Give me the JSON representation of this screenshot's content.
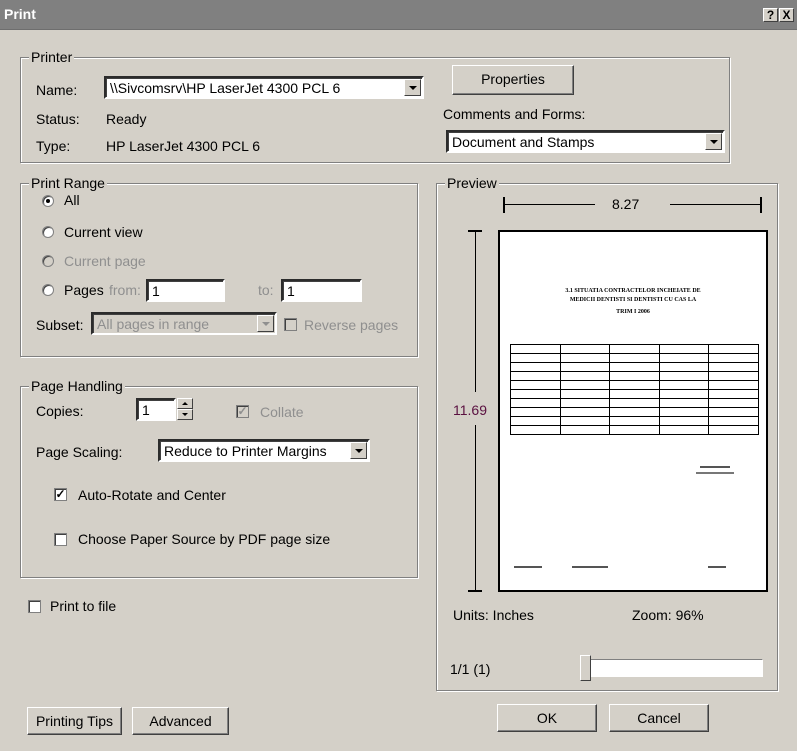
{
  "window": {
    "title": "Print",
    "help_label": "?",
    "close_label": "X"
  },
  "printer": {
    "group_label": "Printer",
    "name_label": "Name:",
    "name_value": "\\\\Sivcomsrv\\HP LaserJet 4300 PCL 6",
    "status_label": "Status:",
    "status_value": "Ready",
    "type_label": "Type:",
    "type_value": "HP LaserJet 4300 PCL 6",
    "properties_label": "Properties",
    "comments_label": "Comments and Forms:",
    "comments_value": "Document and Stamps"
  },
  "print_range": {
    "group_label": "Print Range",
    "all_label": "All",
    "current_view_label": "Current view",
    "current_page_label": "Current page",
    "pages_label": "Pages",
    "from_label": "from:",
    "from_value": "1",
    "to_label": "to:",
    "to_value": "1",
    "subset_label": "Subset:",
    "subset_value": "All pages in range",
    "reverse_label": "Reverse pages",
    "selected": "All"
  },
  "page_handling": {
    "group_label": "Page Handling",
    "copies_label": "Copies:",
    "copies_value": "1",
    "collate_label": "Collate",
    "scaling_label": "Page Scaling:",
    "scaling_value": "Reduce to Printer Margins",
    "auto_rotate_label": "Auto-Rotate and Center",
    "auto_rotate_checked": true,
    "paper_source_label": "Choose Paper Source by PDF page size",
    "paper_source_checked": false
  },
  "print_to_file_label": "Print to file",
  "preview": {
    "group_label": "Preview",
    "width_value": "8.27",
    "height_value": "11.69",
    "units_text": "Units: Inches",
    "zoom_text": "Zoom:  96%",
    "page_indicator": "1/1 (1)",
    "doc_title_line1": "3.1 SITUATIA CONTRACTELOR INCHEIATE DE",
    "doc_title_line2": "MEDICII DENTISTI SI DENTISTI CU CAS LA",
    "doc_title_line3": "TRIM I 2006"
  },
  "buttons": {
    "printing_tips": "Printing Tips",
    "advanced": "Advanced",
    "ok": "OK",
    "cancel": "Cancel"
  }
}
